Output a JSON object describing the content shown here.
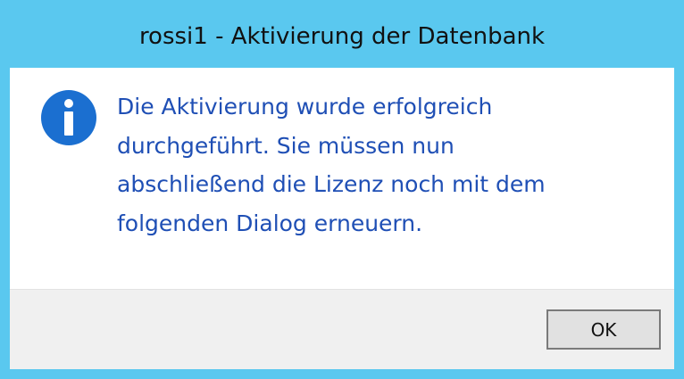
{
  "window": {
    "title": "rossi1 - Aktivierung der Datenbank",
    "accent_color": "#5ac8ef"
  },
  "message": {
    "icon": "info-icon",
    "lines": [
      "Die Aktivierung wurde erfolgreich",
      "durchgeführt. Sie müssen nun",
      "abschließend die Lizenz noch mit dem",
      "folgenden Dialog erneuern."
    ],
    "text_color": "#1f4fb5"
  },
  "buttons": {
    "ok_label": "OK"
  }
}
